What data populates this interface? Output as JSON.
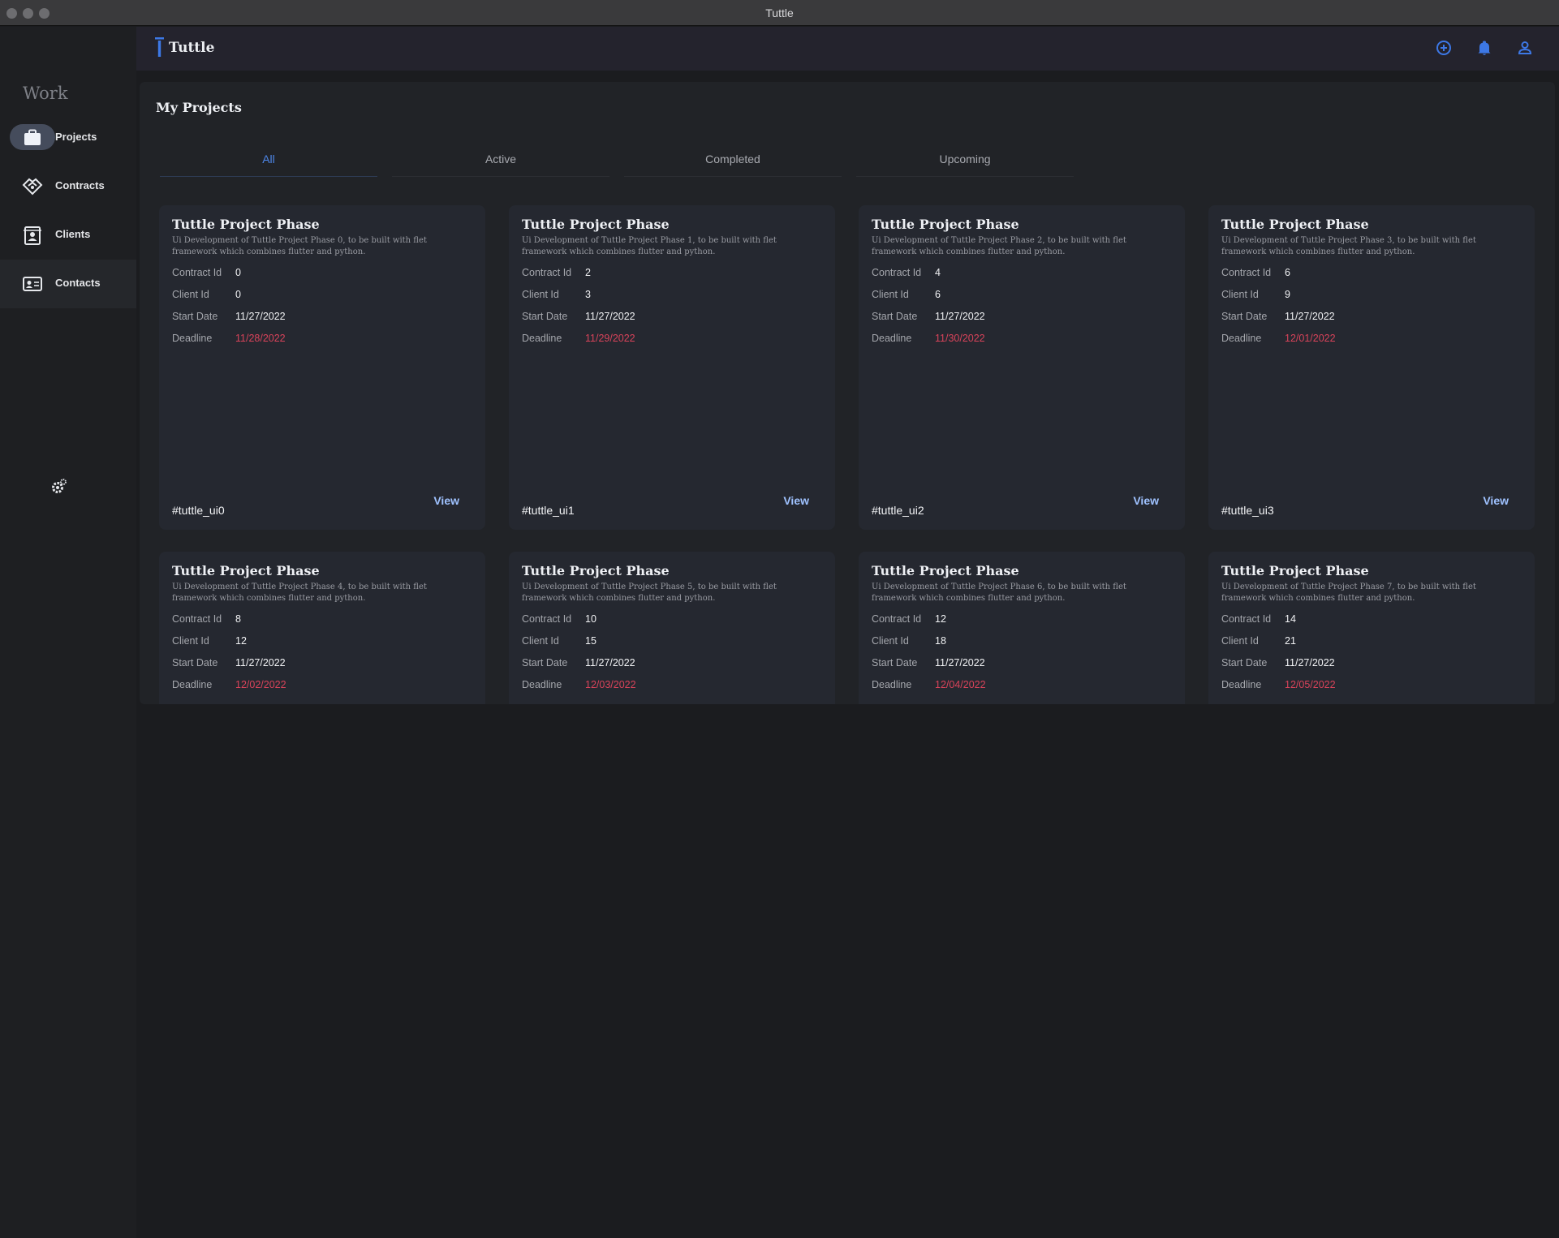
{
  "window": {
    "title": "Tuttle"
  },
  "appbar": {
    "title": "Tuttle",
    "add_icon": "add-circle-icon",
    "notifications_icon": "bell-icon",
    "account_icon": "person-icon",
    "accent_color": "#3d78e6"
  },
  "sidebar": {
    "section_title": "Work",
    "items": [
      {
        "label": "Projects",
        "icon": "briefcase-icon",
        "selected": true
      },
      {
        "label": "Contracts",
        "icon": "handshake-icon",
        "selected": false
      },
      {
        "label": "Clients",
        "icon": "contact-book-icon",
        "selected": false
      },
      {
        "label": "Contacts",
        "icon": "contact-card-icon",
        "selected": false
      }
    ],
    "settings_icon": "gear-icon"
  },
  "main": {
    "title": "My Projects",
    "tabs": [
      {
        "label": "All",
        "active": true
      },
      {
        "label": "Active",
        "active": false
      },
      {
        "label": "Completed",
        "active": false
      },
      {
        "label": "Upcoming",
        "active": false
      }
    ],
    "field_labels": {
      "contract_id": "Contract Id",
      "client_id": "Client Id",
      "start_date": "Start Date",
      "deadline": "Deadline"
    },
    "view_label": "View",
    "deadline_color": "#d9435a",
    "projects": [
      {
        "title": "Tuttle Project Phase",
        "description": "Ui Development of Tuttle Project Phase 0, to be built with flet framework which combines flutter and python.",
        "contract_id": "0",
        "client_id": "0",
        "start_date": "11/27/2022",
        "deadline": "11/28/2022",
        "tag": "#tuttle_ui0"
      },
      {
        "title": "Tuttle Project Phase",
        "description": "Ui Development of Tuttle Project Phase 1, to be built with flet framework which combines flutter and python.",
        "contract_id": "2",
        "client_id": "3",
        "start_date": "11/27/2022",
        "deadline": "11/29/2022",
        "tag": "#tuttle_ui1"
      },
      {
        "title": "Tuttle Project Phase",
        "description": "Ui Development of Tuttle Project Phase 2, to be built with flet framework which combines flutter and python.",
        "contract_id": "4",
        "client_id": "6",
        "start_date": "11/27/2022",
        "deadline": "11/30/2022",
        "tag": "#tuttle_ui2"
      },
      {
        "title": "Tuttle Project Phase",
        "description": "Ui Development of Tuttle Project Phase 3, to be built with flet framework which combines flutter and python.",
        "contract_id": "6",
        "client_id": "9",
        "start_date": "11/27/2022",
        "deadline": "12/01/2022",
        "tag": "#tuttle_ui3"
      },
      {
        "title": "Tuttle Project Phase",
        "description": "Ui Development of Tuttle Project Phase 4, to be built with flet framework which combines flutter and python.",
        "contract_id": "8",
        "client_id": "12",
        "start_date": "11/27/2022",
        "deadline": "12/02/2022"
      },
      {
        "title": "Tuttle Project Phase",
        "description": "Ui Development of Tuttle Project Phase 5, to be built with flet framework which combines flutter and python.",
        "contract_id": "10",
        "client_id": "15",
        "start_date": "11/27/2022",
        "deadline": "12/03/2022"
      },
      {
        "title": "Tuttle Project Phase",
        "description": "Ui Development of Tuttle Project Phase 6, to be built with flet framework which combines flutter and python.",
        "contract_id": "12",
        "client_id": "18",
        "start_date": "11/27/2022",
        "deadline": "12/04/2022"
      },
      {
        "title": "Tuttle Project Phase",
        "description": "Ui Development of Tuttle Project Phase 7, to be built with flet framework which combines flutter and python.",
        "contract_id": "14",
        "client_id": "21",
        "start_date": "11/27/2022",
        "deadline": "12/05/2022"
      }
    ]
  }
}
